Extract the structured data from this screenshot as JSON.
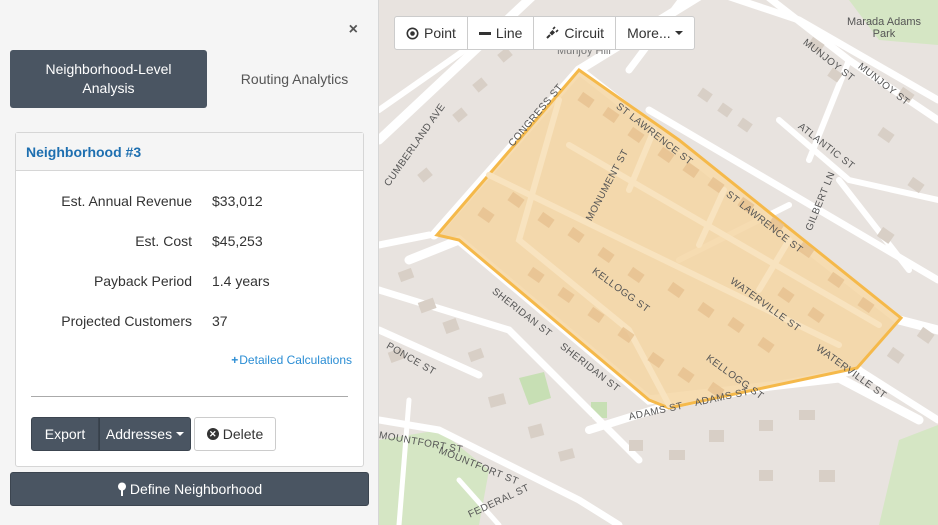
{
  "sidebar": {
    "close_symbol": "×",
    "tabs": {
      "active_label": "Neighborhood-Level Analysis",
      "inactive_label": "Routing Analytics"
    },
    "panel": {
      "title": "Neighborhood #3",
      "stats": [
        {
          "label": "Est. Annual Revenue",
          "value": "$33,012"
        },
        {
          "label": "Est. Cost",
          "value": "$45,253"
        },
        {
          "label": "Payback Period",
          "value": "1.4 years"
        },
        {
          "label": "Projected Customers",
          "value": "37"
        }
      ],
      "details_link": "Detailed Calculations",
      "export_label": "Export",
      "addresses_label": "Addresses",
      "delete_label": "Delete"
    },
    "define_label": "Define Neighborhood"
  },
  "toolbar": {
    "point_label": "Point",
    "line_label": "Line",
    "circuit_label": "Circuit",
    "more_label": "More..."
  },
  "map": {
    "labels": {
      "park": "Marada Adams\nPark",
      "munjoy1": "MUNJOY ST",
      "munjoy2": "MUNJOY ST",
      "atlantic": "ATLANTIC ST",
      "gilbert": "GILBERT LN",
      "congress": "CONGRESS ST",
      "stlawrence1": "ST LAWRENCE ST",
      "stlawrence2": "ST LAWRENCE ST",
      "monument": "MONUMENT ST",
      "cumberland": "CUMBERLAND AVE",
      "kellogg1": "KELLOGG ST",
      "kellogg2": "KELLOGG ST",
      "waterville1": "WATERVILLE ST",
      "waterville2": "WATERVILLE ST",
      "sheridan1": "SHERIDAN ST",
      "sheridan2": "SHERIDAN ST",
      "ponce": "PONCE ST",
      "adams1": "ADAMS ST",
      "adams2": "ADAMS ST",
      "mountfort1": "MOUNTFORT ST",
      "mountfort2": "MOUNTFORT ST",
      "federal": "FEDERAL ST",
      "munjoy_hill": "Munjoy Hill"
    },
    "colors": {
      "base": "#e8e3df",
      "road": "#ffffff",
      "building": "#d7cfc7",
      "park": "#c7dfb4",
      "selection_fill": "#f4d6a3",
      "selection_stroke": "#f5b94a"
    }
  }
}
